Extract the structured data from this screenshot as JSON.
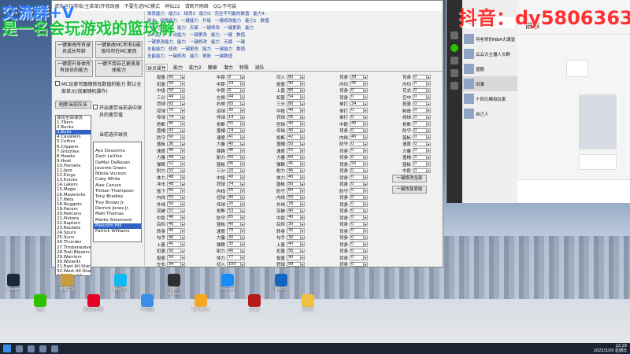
{
  "overlay": {
    "line1": "交流群+V",
    "line2": "是一名会玩游戏的篮球解",
    "douyin": "抖音：dy5806363"
  },
  "trainer": {
    "title_items": [
      "请先运行游戏(主菜单)开修改器",
      "不要先进MC模式",
      "神仙22",
      "请断开网络",
      "QQ:不可装"
    ],
    "left_buttons": {
      "b1": "一键更改所有球员成长年龄",
      "b2": "一键更改MC所有D能级均可在MC更改",
      "b3": "一键提升身体所有球员的能力",
      "b4": "一键不用自己更改身体能力"
    },
    "mc_check": "MC玩家可跟随修改数值的能力 默认全部单元(效果随机操作)",
    "team_list_label": "刷新当前队伍",
    "choose_player_label": "当前选中球员",
    "fatigue_check": "开启疲劳当前选中球员的疲劳值",
    "teams": [
      "球员全部球员",
      "1.76ers",
      "2.Bucks",
      "3.Bulls",
      "4.Cavaliers",
      "5.Celtics",
      "6.Clippers",
      "7.Grizzlies",
      "8.Hawks",
      "9.Heat",
      "10.Hornets",
      "11.Jazz",
      "12.Kings",
      "13.Knicks",
      "14.Lakers",
      "15.Magic",
      "16.Mavericks",
      "17.Nets",
      "18.Nuggets",
      "19.Pacers",
      "20.Pelicans",
      "21.Pistons",
      "22.Raptors",
      "23.Rockets",
      "24.Spurs",
      "25.Suns",
      "26.Thunder",
      "27.Timberwolves",
      "28.Trail Blazers",
      "29.Warriors",
      "30.Wizards",
      "31.East All-Stars",
      "32.West All-Stars",
      "33.Years GC"
    ],
    "selected_team_index": 3,
    "players": [
      "Ayo Dosunmu",
      "Zach LaVine",
      "DeMar DeRozan",
      "Javonte Green",
      "Nikola Vucevic",
      "Coby White",
      "Alex Caruso",
      "Tristan Thompson",
      "Tony Bradley",
      "Troy Brown Jr.",
      "Derrick Jones Jr.",
      "Matt Thomas",
      "Marko Simonovic",
      "Malcolm Hill",
      "Patrick Williams"
    ],
    "selected_player_index": 13,
    "menu_rows": [
      [
        "球员能力",
        "能力1",
        "球员2",
        "能力3",
        "完全不可能的数值",
        "能力4"
      ],
      [
        "能力",
        "切换能力",
        "一键能力",
        "升级",
        "一键修改能力",
        "能力1",
        "数值"
      ],
      [
        "一键更改能力",
        "能力",
        "天赋",
        "一键修改",
        "一键更新",
        "能力"
      ],
      [
        "系列能力",
        "更改能力",
        "一键更改",
        "能力",
        "一键",
        "数值"
      ],
      [
        "一键更改能力",
        "能力",
        "一键修改",
        "能力",
        "天赋",
        "一键"
      ],
      [
        "全能能力",
        "修改",
        "一键更改",
        "能力",
        "一键能力",
        "数值"
      ],
      [
        "全能能力",
        "一键修改",
        "能力",
        "更新",
        "一键数值"
      ]
    ],
    "tabs": [
      "球员属性",
      "能力",
      "能力2",
      "徽章",
      "潜力",
      "特殊",
      "球队"
    ],
    "active_tab": 0,
    "col1": [
      [
        "投篮",
        "60"
      ],
      [
        "扣篮",
        "56"
      ],
      [
        "中投",
        "50"
      ],
      [
        "三分",
        "44"
      ],
      [
        "罚球",
        "65"
      ],
      [
        "控球",
        "70"
      ],
      [
        "传球",
        "74"
      ],
      [
        "抢断",
        "45"
      ],
      [
        "盖帽",
        "43"
      ],
      [
        "防守",
        "60"
      ],
      [
        "篮板",
        "36"
      ],
      [
        "速度",
        "46"
      ],
      [
        "力量",
        "49"
      ],
      [
        "弹跳",
        "52"
      ],
      [
        "耐力",
        "55"
      ],
      [
        "体力",
        "48"
      ],
      [
        "冲击",
        "48"
      ],
      [
        "篮下",
        "60"
      ],
      [
        "内线",
        "55"
      ],
      [
        "外线",
        "56"
      ],
      [
        "突破",
        "57"
      ],
      [
        "中距",
        "46"
      ],
      [
        "后仰",
        "46"
      ],
      [
        "转身",
        "46"
      ],
      [
        "勾手",
        "46"
      ],
      [
        "上篮",
        "40"
      ],
      [
        "扣篮",
        "50"
      ],
      [
        "投篮",
        "50"
      ],
      [
        "左右",
        "34"
      ]
    ],
    "col2": [
      [
        "中距",
        "9"
      ],
      [
        "中距",
        "24"
      ],
      [
        "中距",
        "8"
      ],
      [
        "左侧",
        "44"
      ],
      [
        "右侧",
        "65"
      ],
      [
        "运球",
        "30"
      ],
      [
        "传球",
        "14"
      ],
      [
        "抢断",
        "55"
      ],
      [
        "盖帽",
        "74"
      ],
      [
        "速度",
        "41"
      ],
      [
        "力量",
        "40"
      ],
      [
        "弹跳",
        "46"
      ],
      [
        "耐力",
        "60"
      ],
      [
        "篮板",
        "66"
      ],
      [
        "三分",
        "20"
      ],
      [
        "中投",
        "40"
      ],
      [
        "罚球",
        "74"
      ],
      [
        "内线",
        "55"
      ],
      [
        "控球",
        "40"
      ],
      [
        "传球",
        "20"
      ],
      [
        "抢断",
        "53"
      ],
      [
        "防守",
        "65"
      ],
      [
        "篮板",
        "40"
      ],
      [
        "速度",
        "70"
      ],
      [
        "力量",
        "30"
      ],
      [
        "弹跳",
        "30"
      ],
      [
        "耐力",
        "40"
      ],
      [
        "体力",
        "77"
      ],
      [
        "切入",
        "100"
      ]
    ],
    "col3": [
      [
        "切入",
        "80"
      ],
      [
        "投篮",
        "90"
      ],
      [
        "上篮",
        "80"
      ],
      [
        "扣篮",
        "54"
      ],
      [
        "三分",
        "80"
      ],
      [
        "中投",
        "40"
      ],
      [
        "罚球",
        "56"
      ],
      [
        "控球",
        "40"
      ],
      [
        "传球",
        "40"
      ],
      [
        "抢断",
        "42"
      ],
      [
        "盖帽",
        "50"
      ],
      [
        "速度",
        "55"
      ],
      [
        "力量",
        "60"
      ],
      [
        "弹跳",
        "45"
      ],
      [
        "耐力",
        "46"
      ],
      [
        "体力",
        "40"
      ],
      [
        "篮板",
        "50"
      ],
      [
        "防守",
        "60"
      ],
      [
        "内线",
        "50"
      ],
      [
        "外线",
        "39"
      ],
      [
        "突破",
        "40"
      ],
      [
        "中距",
        "40"
      ],
      [
        "后仰",
        "30"
      ],
      [
        "转身",
        "30"
      ],
      [
        "勾手",
        "30"
      ],
      [
        "上篮",
        "40"
      ],
      [
        "扣篮",
        "56"
      ],
      [
        "投篮",
        "90"
      ],
      [
        "罚球",
        "99"
      ]
    ],
    "col4": [
      [
        "背身",
        "39"
      ],
      [
        "内切",
        "45"
      ],
      [
        "背身",
        "0"
      ],
      [
        "背身",
        "0"
      ],
      [
        "单打",
        "34"
      ],
      [
        "单打",
        "0"
      ],
      [
        "单打",
        "0"
      ],
      [
        "中距",
        "40"
      ],
      [
        "背身",
        "0"
      ],
      [
        "内线",
        "40"
      ],
      [
        "防守",
        "0"
      ],
      [
        "背身",
        "0"
      ],
      [
        "背身",
        "0"
      ],
      [
        "背身",
        "50"
      ],
      [
        "背身",
        "0"
      ],
      [
        "背身",
        "0"
      ],
      [
        "背身",
        "0"
      ],
      [
        "防守",
        "0"
      ],
      [
        "背身",
        "0"
      ],
      [
        "背身",
        "0"
      ],
      [
        "背身",
        "0"
      ],
      [
        "背身",
        "0"
      ],
      [
        "背身",
        "0"
      ],
      [
        "背身",
        "0"
      ],
      [
        "背身",
        "0"
      ],
      [
        "背身",
        "0"
      ],
      [
        "背身",
        "0"
      ],
      [
        "背身",
        "0"
      ],
      [
        "背身",
        "0"
      ]
    ],
    "col5": [
      [
        "背身",
        "0"
      ],
      [
        "内切",
        "0"
      ],
      [
        "花式",
        "0"
      ],
      [
        "空中",
        "0"
      ],
      [
        "投篮",
        "0"
      ],
      [
        "制造",
        "0"
      ],
      [
        "持球",
        "0"
      ],
      [
        "抢断",
        "0"
      ],
      [
        "防守",
        "0"
      ],
      [
        "篮板",
        "0"
      ],
      [
        "速度",
        "0"
      ],
      [
        "力量",
        "0"
      ],
      [
        "盖帽",
        "0"
      ],
      [
        "篮板",
        "0"
      ],
      [
        "中距",
        "0"
      ]
    ],
    "grid_buttons": {
      "apply_all": "一键修改全部",
      "restore": "一键恢复原始"
    }
  },
  "chat": {
    "search_placeholder": "搜索",
    "title": "旧事",
    "items": [
      "何老师的NBA大课堂",
      "云云大主播人头群",
      "盛鹏",
      "旧事",
      "十四元模拟玩家",
      "自己人"
    ],
    "active_index": 3
  },
  "desktop_icons": [
    "steam",
    "微信",
    "英雄联盟",
    "网易云音乐",
    "腾讯QQ",
    "TV直播",
    "OBS Studio",
    "WeGame",
    "Blizzard",
    "2K22",
    "NBA2K",
    "文件夹"
  ],
  "tray": {
    "time": "22:29",
    "date": "2022/3/20 星期日"
  }
}
